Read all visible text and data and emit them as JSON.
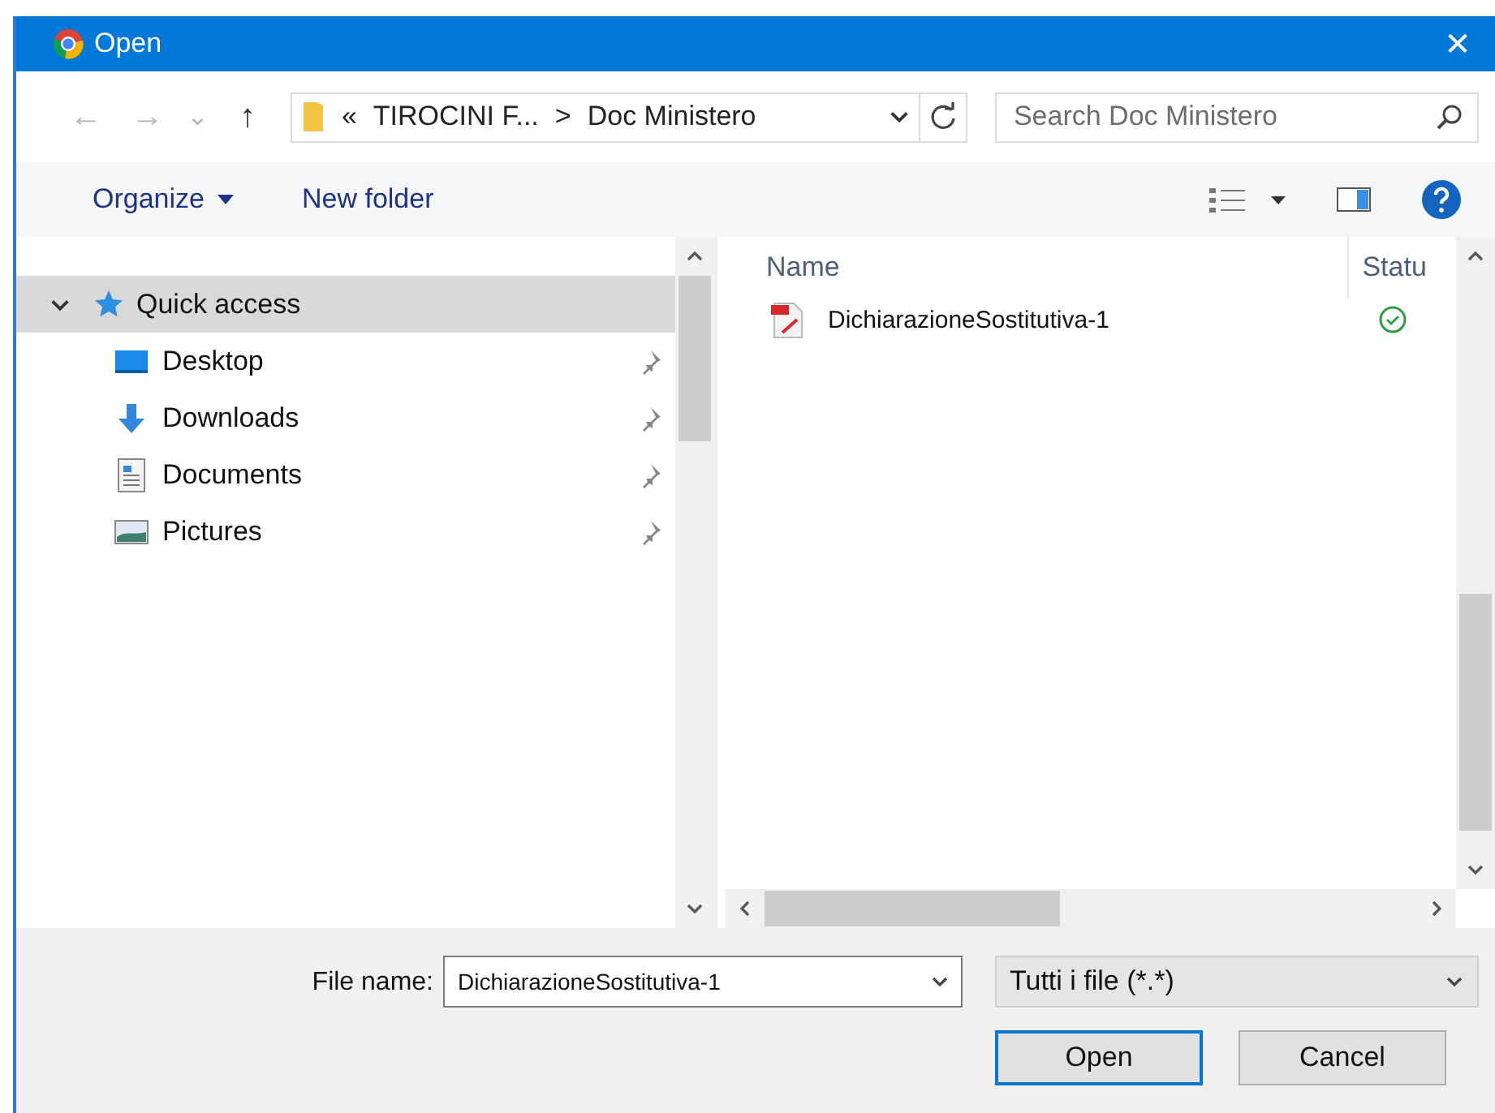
{
  "window": {
    "title": "Open",
    "close": "✕"
  },
  "address": {
    "back": "←",
    "forward": "→",
    "recent": "⌄",
    "up": "↑",
    "overflow": "«",
    "segments": [
      "TIROCINI F...",
      "Doc Ministero"
    ],
    "separator": ">"
  },
  "search": {
    "placeholder": "Search Doc Ministero"
  },
  "toolbar": {
    "organize": "Organize",
    "new_folder": "New folder"
  },
  "navigation": {
    "items": [
      {
        "label": "Quick access",
        "kind": "star",
        "selected": true,
        "expanded": true,
        "children": [
          {
            "label": "Desktop",
            "kind": "desktop",
            "selected": false,
            "pinned": true
          },
          {
            "label": "Downloads",
            "kind": "downloads",
            "selected": false,
            "pinned": true
          },
          {
            "label": "Documents",
            "kind": "documents",
            "selected": false,
            "pinned": true
          },
          {
            "label": "Pictures",
            "kind": "pictures",
            "selected": false,
            "pinned": true
          }
        ]
      }
    ]
  },
  "file_list": {
    "columns": [
      "Name",
      "Statu"
    ],
    "rows": [
      {
        "name": "DichiarazioneSostitutiva-1",
        "kind": "pdf",
        "selected": false,
        "synced": true
      }
    ]
  },
  "footer": {
    "file_name_label": "File name:",
    "file_name": "DichiarazioneSostitutiva-1",
    "file_type": "Tutti i file (*.*)",
    "buttons": [
      {
        "label": "Open",
        "default": true
      },
      {
        "label": "Cancel",
        "default": false
      }
    ]
  }
}
